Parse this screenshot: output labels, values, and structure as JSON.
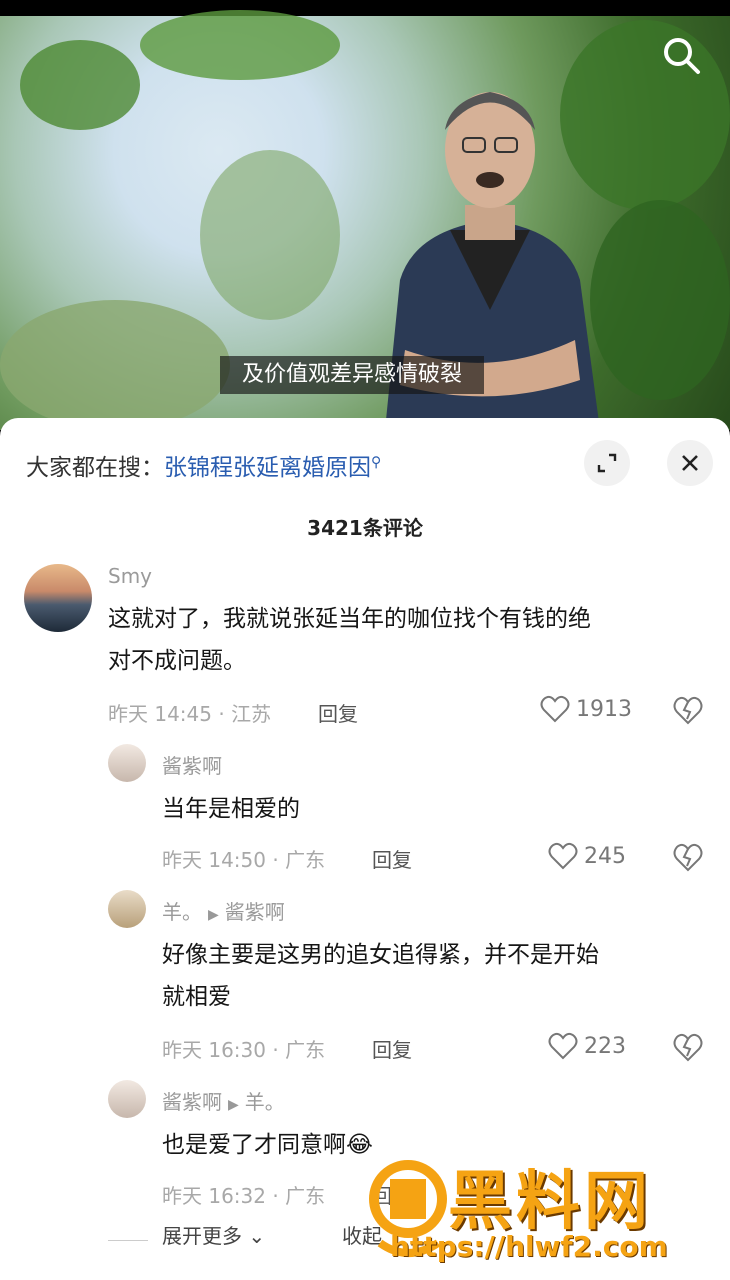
{
  "video": {
    "subtitle": "及价值观差异感情破裂"
  },
  "hot_search": {
    "prefix": "大家都在搜：",
    "keyword": "张锦程张延离婚原因"
  },
  "comments_header": {
    "count_text": "3421条评论"
  },
  "comments": [
    {
      "user": "Smy",
      "text_line1": "这就对了，我就说张延当年的咖位找个有钱的绝",
      "text_line2": "对不成问题。",
      "meta": "昨天 14:45 · 江苏",
      "reply": "回复",
      "likes": "1913"
    },
    {
      "user": "酱紫啊",
      "text": "当年是相爱的",
      "meta": "昨天 14:50 · 广东",
      "reply": "回复",
      "likes": "245"
    },
    {
      "user": "羊。",
      "reply_to": "酱紫啊",
      "text_line1": "好像主要是这男的追女追得紧，并不是开始",
      "text_line2": "就相爱",
      "meta": "昨天 16:30 · 广东",
      "reply": "回复",
      "likes": "223"
    },
    {
      "user": "酱紫啊",
      "reply_to": "羊。",
      "text": "也是爱了才同意啊",
      "emoji": "😂",
      "meta": "昨天 16:32 · 广东",
      "reply": "回"
    }
  ],
  "footer": {
    "expand": "展开更多",
    "collapse": "收起"
  },
  "watermark": {
    "brand": "黑料网",
    "url": "https://hlwf2.com"
  }
}
